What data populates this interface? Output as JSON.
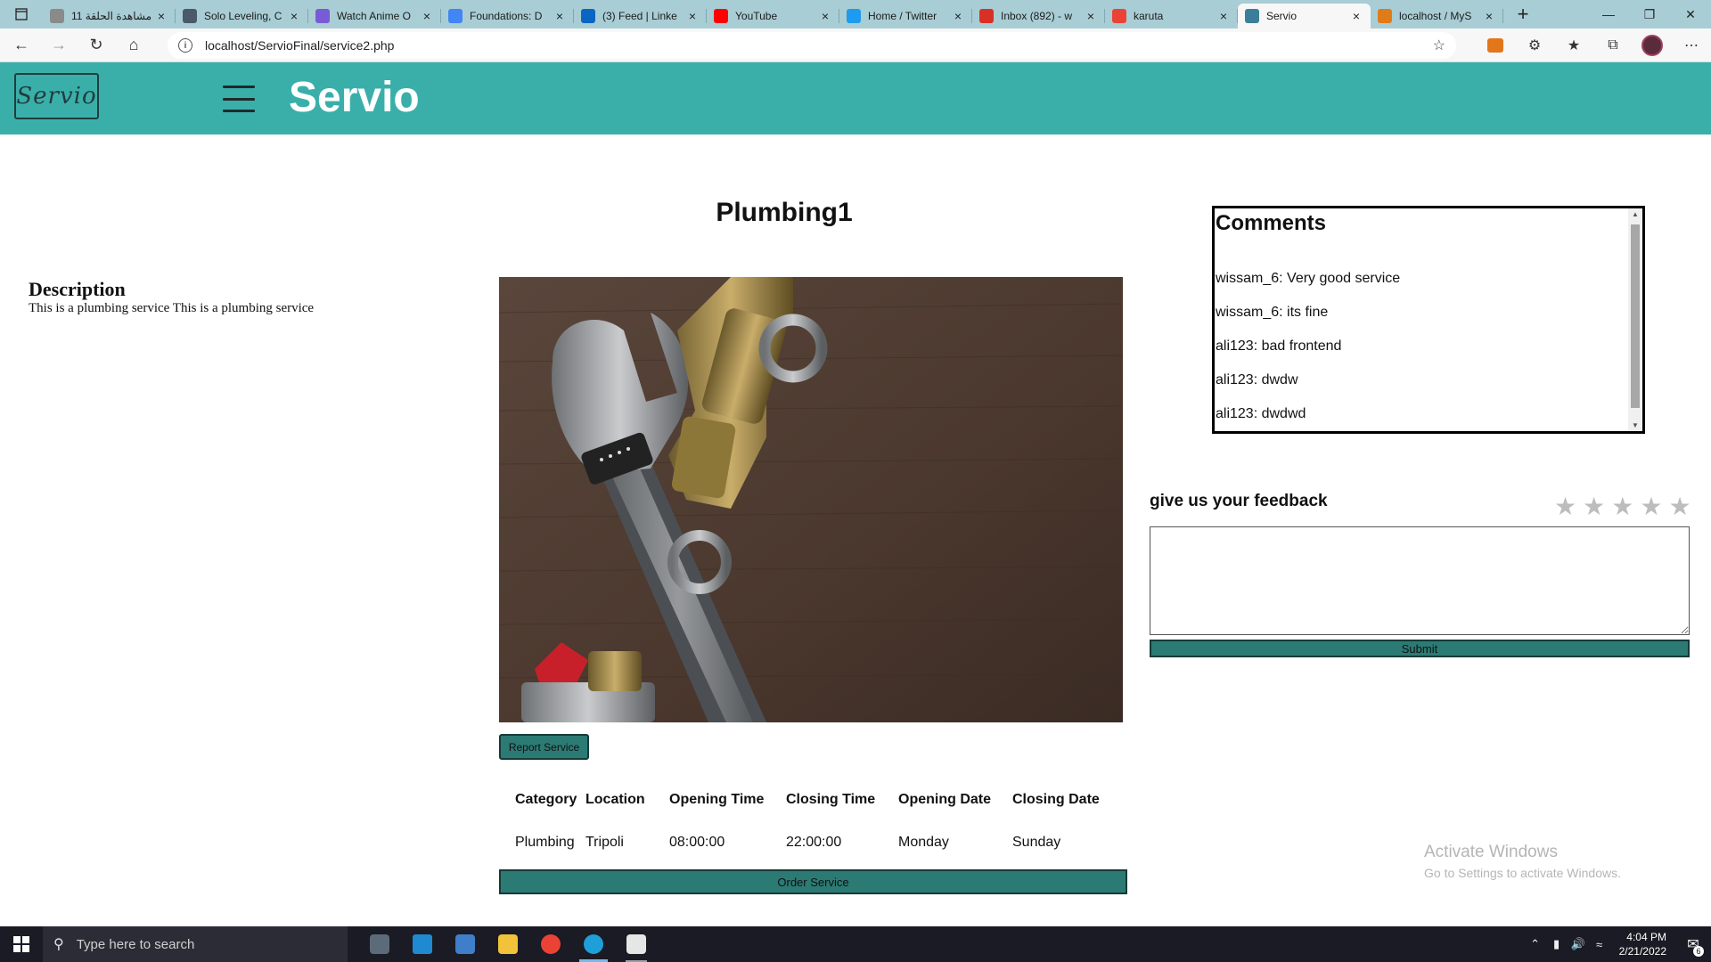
{
  "browser": {
    "tabs": [
      {
        "title": "مشاهدة الحلقة 11",
        "favicon": "generic-page",
        "color": "#8a8a8a",
        "active": false
      },
      {
        "title": "Solo Leveling, C",
        "favicon": "shield-icon",
        "color": "#4a5a6a",
        "active": false
      },
      {
        "title": "Watch Anime O",
        "favicon": "play-icon",
        "color": "#7a5bd6",
        "active": false
      },
      {
        "title": "Foundations: D",
        "favicon": "google-icon",
        "color": "#4285f4",
        "active": false
      },
      {
        "title": "(3) Feed | Linke",
        "favicon": "linkedin-icon",
        "color": "#0a66c2",
        "active": false
      },
      {
        "title": "YouTube",
        "favicon": "youtube-icon",
        "color": "#ff0000",
        "active": false
      },
      {
        "title": "Home / Twitter",
        "favicon": "twitter-icon",
        "color": "#1d9bf0",
        "active": false
      },
      {
        "title": "Inbox (892) - w",
        "favicon": "gmail-icon",
        "color": "#d93025",
        "active": false
      },
      {
        "title": "karuta",
        "favicon": "google-icon",
        "color": "#ea4335",
        "active": false
      },
      {
        "title": "Servio",
        "favicon": "page-icon",
        "color": "#3c7d99",
        "active": true
      },
      {
        "title": "localhost / MyS",
        "favicon": "phpmyadmin-icon",
        "color": "#e07b1a",
        "active": false
      }
    ],
    "address": "localhost/ServioFinal/service2.php"
  },
  "site": {
    "logo_text": "Servio",
    "title": "Servio",
    "brand_color": "#3aafaa",
    "button_color": "#2c7a74"
  },
  "service": {
    "name": "Plumbing1",
    "description_heading": "Description",
    "description": "This is a plumbing service This is a plumbing service",
    "report_button": "Report Service",
    "order_button": "Order Service",
    "table": {
      "headers": [
        "Category",
        "Location",
        "Opening Time",
        "Closing Time",
        "Opening Date",
        "Closing Date"
      ],
      "row": [
        "Plumbing",
        "Tripoli",
        "08:00:00",
        "22:00:00",
        "Monday",
        "Sunday"
      ]
    }
  },
  "comments": {
    "heading": "Comments",
    "items": [
      "wissam_6: Very good service",
      "wissam_6: its fine",
      "ali123: bad frontend",
      "ali123: dwdw",
      "ali123: dwdwd"
    ]
  },
  "feedback": {
    "heading": "give us your feedback",
    "stars": 5,
    "rating": 0,
    "submit": "Submit"
  },
  "watermark": {
    "line1": "Activate Windows",
    "line2": "Go to Settings to activate Windows."
  },
  "taskbar": {
    "search_placeholder": "Type here to search",
    "time": "4:04 PM",
    "date": "2/21/2022",
    "notification_count": "6"
  }
}
